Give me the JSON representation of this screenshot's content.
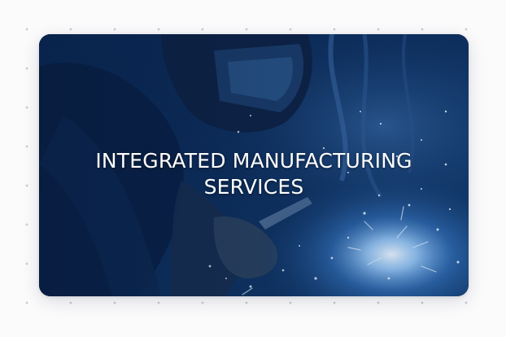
{
  "card": {
    "title_line_1": "INTEGRATED MANUFACTURING",
    "title_line_2": "SERVICES",
    "image_subject": "welder-welding-sparks-photo"
  },
  "colors": {
    "page_background": "#fbfbfc",
    "dot_grid": "#c9ccd3",
    "image_tint": "#0b2a55",
    "title_text": "#ffffff"
  }
}
